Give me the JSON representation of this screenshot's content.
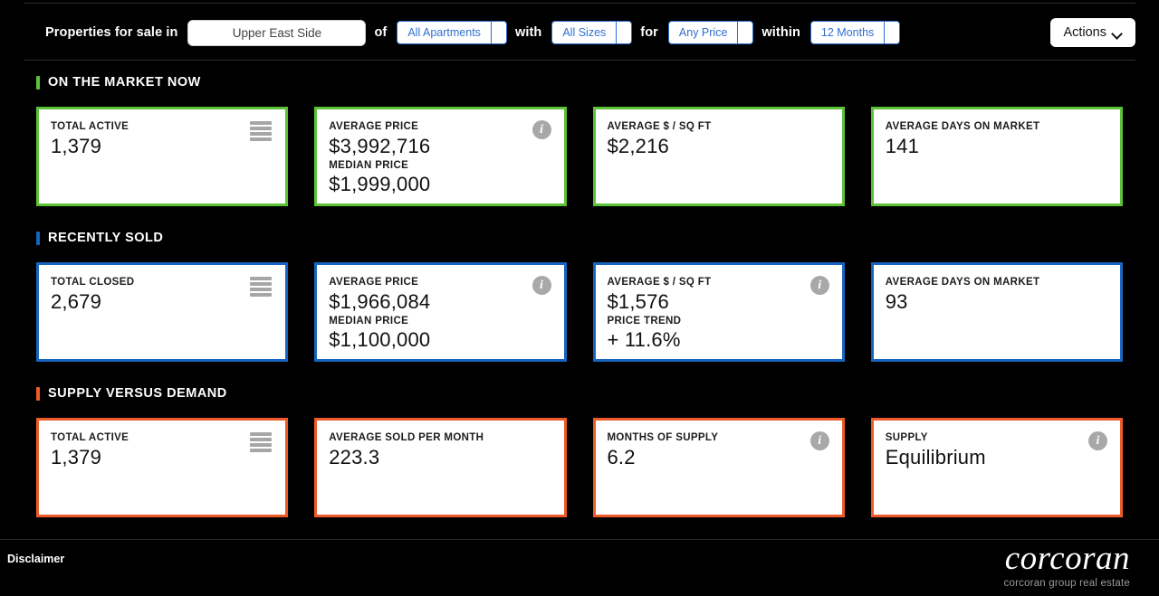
{
  "filter_bar": {
    "prefix_label": "Properties for sale in",
    "location": {
      "value": "Upper East Side",
      "placeholder": "Enter a neighborhood"
    },
    "sep_of": "of",
    "property_type": {
      "value": "All Apartments"
    },
    "sep_with": "with",
    "size": {
      "value": "All Sizes"
    },
    "sep_for": "for",
    "price": {
      "value": "Any Price"
    },
    "sep_within": "within",
    "timeframe": {
      "value": "12 Months"
    },
    "actions_label": "Actions",
    "actions_icon": "chevron-down-icon"
  },
  "sections": [
    {
      "id": "on-the-market-now",
      "title": "ON THE MARKET NOW",
      "accent": "#5bc236",
      "cards": [
        {
          "name": "total-active",
          "label": "TOTAL ACTIVE",
          "value": "1,379",
          "icon": "list-icon"
        },
        {
          "name": "average-price",
          "label": "AVERAGE PRICE",
          "value": "$3,992,716",
          "label2": "MEDIAN PRICE",
          "value2": "$1,999,000",
          "icon": "info-icon"
        },
        {
          "name": "average-price-per-sq-ft",
          "label": "AVERAGE $ / SQ FT",
          "value": "$2,216",
          "icon": null
        },
        {
          "name": "average-days-on-market",
          "label": "AVERAGE DAYS ON MARKET",
          "value": "141",
          "icon": null
        }
      ]
    },
    {
      "id": "recently-sold",
      "title": "RECENTLY SOLD",
      "accent": "#1665c0",
      "cards": [
        {
          "name": "total-closed",
          "label": "TOTAL CLOSED",
          "value": "2,679",
          "icon": "list-icon"
        },
        {
          "name": "average-price",
          "label": "AVERAGE PRICE",
          "value": "$1,966,084",
          "label2": "MEDIAN PRICE",
          "value2": "$1,100,000",
          "icon": "info-icon"
        },
        {
          "name": "average-price-per-sq-ft",
          "label": "AVERAGE $ / SQ FT",
          "value": "$1,576",
          "label2": "PRICE TREND",
          "value2": "+ 11.6%",
          "icon": "info-icon"
        },
        {
          "name": "average-days-on-market",
          "label": "AVERAGE DAYS ON MARKET",
          "value": "93",
          "icon": null
        }
      ]
    },
    {
      "id": "supply-versus-demand",
      "title": "SUPPLY VERSUS DEMAND",
      "accent": "#ee5b28",
      "cards": [
        {
          "name": "total-active",
          "label": "TOTAL ACTIVE",
          "value": "1,379",
          "icon": "list-icon"
        },
        {
          "name": "average-sold-per-month",
          "label": "AVERAGE SOLD PER MONTH",
          "value": "223.3",
          "icon": null
        },
        {
          "name": "months-of-supply",
          "label": "MONTHS OF SUPPLY",
          "value": "6.2",
          "icon": "info-icon"
        },
        {
          "name": "supply",
          "label": "SUPPLY",
          "value": "Equilibrium",
          "icon": "info-icon"
        }
      ]
    }
  ],
  "footer": {
    "disclaimer_label": "Disclaimer",
    "logo_name": "corcoran",
    "logo_tagline": "corcoran group real estate"
  }
}
